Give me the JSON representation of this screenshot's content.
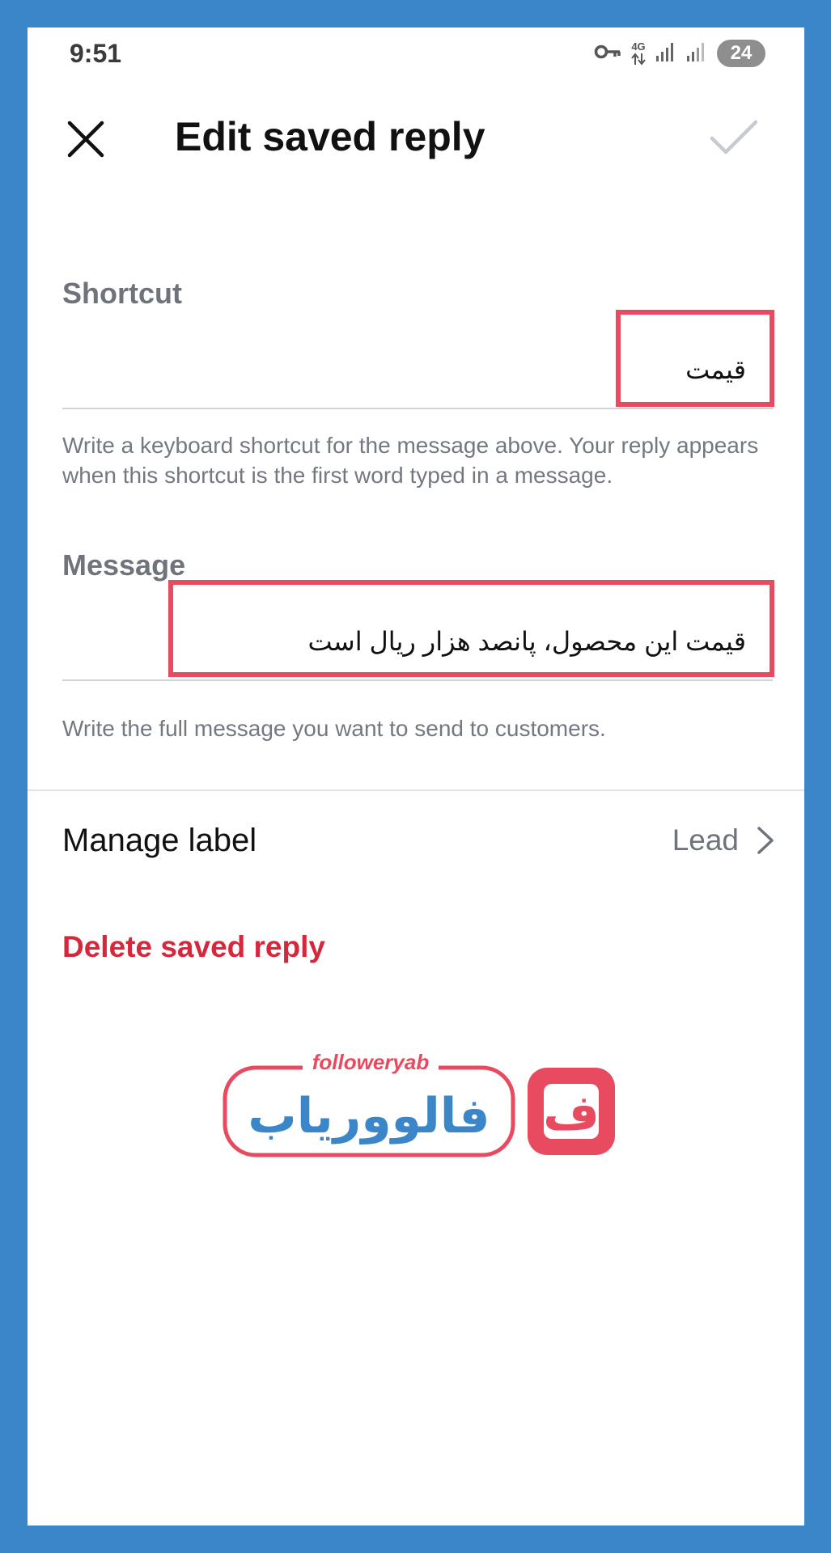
{
  "status_bar": {
    "time": "9:51",
    "network_type": "4G",
    "battery": "24",
    "icons": [
      "vpn-key-icon",
      "network-arrows-icon",
      "signal-icon",
      "signal-icon"
    ]
  },
  "app_bar": {
    "title": "Edit saved reply",
    "close_icon": "close-icon",
    "confirm_icon": "check-icon"
  },
  "shortcut": {
    "label": "Shortcut",
    "value": "قیمت",
    "helper": "Write a keyboard shortcut for the message above. Your reply appears when this shortcut is the first word typed in a message."
  },
  "message": {
    "label": "Message",
    "value": "قیمت این محصول، پانصد هزار ریال است",
    "helper": "Write the full message you want to send to customers."
  },
  "manage_label": {
    "label": "Manage label",
    "value": "Lead",
    "icon": "chevron-right-icon"
  },
  "delete_label": "Delete saved reply",
  "watermark": {
    "latin_text": "followeryab",
    "persian_text": "فالووریاب",
    "icon_letter": "ف"
  },
  "colors": {
    "frame": "#3a86c8",
    "highlight": "#e84a5f",
    "delete": "#d6283c",
    "logo_blue": "#3a86c8",
    "logo_red": "#e84a5f"
  }
}
